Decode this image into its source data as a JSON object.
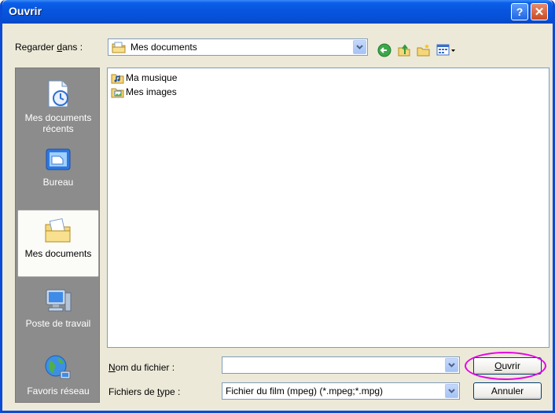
{
  "window": {
    "title": "Ouvrir",
    "help_glyph": "?",
    "close_glyph": "✕"
  },
  "lookin": {
    "label_pre": "Regarder ",
    "label_accel": "d",
    "label_post": "ans :",
    "value": "Mes documents"
  },
  "places": [
    {
      "id": "recent",
      "label": "Mes documents récents"
    },
    {
      "id": "desktop",
      "label": "Bureau"
    },
    {
      "id": "mydocs",
      "label": "Mes documents",
      "active": true
    },
    {
      "id": "mycomputer",
      "label": "Poste de travail"
    },
    {
      "id": "network",
      "label": "Favoris réseau"
    }
  ],
  "files": [
    {
      "name": "Ma musique"
    },
    {
      "name": "Mes images"
    }
  ],
  "filename": {
    "label_accel": "N",
    "label_post": "om du fichier :",
    "value": ""
  },
  "filetype": {
    "label_pre": "Fichiers de ",
    "label_accel": "t",
    "label_post": "ype :",
    "value": "Fichier du film (mpeg) (*.mpeg;*.mpg)"
  },
  "buttons": {
    "open_accel": "O",
    "open_post": "uvrir",
    "cancel": "Annuler"
  },
  "colors": {
    "titlebar": "#0855dd",
    "dialog_bg": "#ece9d8",
    "places_bg": "#8c8c8c",
    "highlight_ring": "#e600e6"
  }
}
